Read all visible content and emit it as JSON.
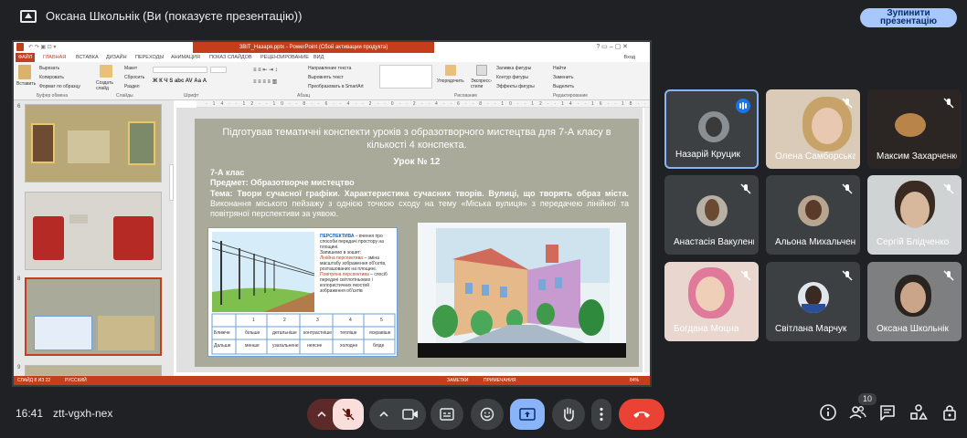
{
  "header": {
    "presenting_label": "Оксана Школьнік (Ви (показуєте презентацію))",
    "stop_button": "Зупинити презентацію",
    "stop_line1": "Зупинити",
    "stop_line2": "презентацію"
  },
  "ppt": {
    "window_title": "ЗВІТ_Назаря.pptx - PowerPoint (Сбой активации продукта)",
    "login": "Вход",
    "tabs": [
      "ФАЙЛ",
      "ГЛАВНАЯ",
      "ВСТАВКА",
      "ДИЗАЙН",
      "ПЕРЕХОДЫ",
      "АНИМАЦИЯ",
      "ПОКАЗ СЛАЙДОВ",
      "РЕЦЕНЗИРОВАНИЕ",
      "ВИД"
    ],
    "ribbon": {
      "paste": "Вставить",
      "cut": "Вырезать",
      "copy": "Копировать",
      "format_painter": "Формат по образцу",
      "clipboard_group": "Буфер обмена",
      "create_slide": "Создать слайд",
      "layout": "Макет",
      "reset": "Сбросить",
      "section": "Раздел",
      "slides_group": "Слайды",
      "font_group": "Шрифт",
      "text_direction": "Направление текста",
      "align_text": "Выровнять текст",
      "smartart": "Преобразовать в SmartArt",
      "paragraph_group": "Абзац",
      "arrange": "Упорядочить",
      "express_styles": "Экспресс-стили",
      "shape_fill": "Заливка фигуры",
      "shape_outline": "Контур фигуры",
      "shape_effects": "Эффекты фигуры",
      "drawing_group": "Рисование",
      "find": "Найти",
      "replace": "Заменить",
      "select": "Выделить",
      "editing_group": "Редактирование"
    },
    "slide_numbers": [
      "6",
      "7",
      "8",
      "9"
    ],
    "slide": {
      "title": "Підготував тематичні конспекти уроків з образотворчого мистецтва для 7-А класу в кількості 4 конспекта.",
      "lesson": "Урок № 12",
      "class_label": "7-А клас",
      "subject": "Предмет: Образотворче мистецтво",
      "theme_bold": "Тема: Твори сучасної графіки. Характеристика сучасних творів. Вулиці, що творять образ міста.",
      "theme_plain": " Виконання міського пейзажу з однією точкою сходу на тему «Міська вулиця» з передачею лінійної та повітряної перспективи за уявою.",
      "perspective_heading": "ПЕРСПЕКТИВА",
      "perspective_text": " – вчення про способи передачі простору на площині.",
      "remember": "Запишемо в зошит:",
      "linear_label": "Лінійна перспектива",
      "linear_text": " – зміна масштабу зображення об'єктів, розташованих на площині.",
      "aerial_label": "Повітряна перспектива",
      "aerial_text": " – спосіб передачі світлотіньових і колористичних якостей зображення об'єктів",
      "table_header": [
        "",
        "1",
        "2",
        "3",
        "4",
        "5"
      ],
      "table_row1": [
        "Ближче",
        "більше",
        "детальніше",
        "контрастніше",
        "тепліше",
        "яскравіше"
      ],
      "table_row2": [
        "Дальше",
        "менше",
        "узагальнене",
        "неясне",
        "холодне",
        "бліде"
      ]
    },
    "status": {
      "slide_of": "СЛАЙД 8 ИЗ 22",
      "language": "РУССКИЙ",
      "notes": "ЗАМЕТКИ",
      "comments": "ПРИМЕЧАНИЯ",
      "zoom": "84%"
    }
  },
  "participants": [
    {
      "name": "Назарій Круцик",
      "state": "speaking"
    },
    {
      "name": "Олена Самборська",
      "state": "muted"
    },
    {
      "name": "Максим Захарченко",
      "state": "muted"
    },
    {
      "name": "Анастасія Вакуленко",
      "state": "muted"
    },
    {
      "name": "Альона Михальченко",
      "state": "muted"
    },
    {
      "name": "Сергій Блідченко",
      "state": "muted"
    },
    {
      "name": "Богдана Моцна",
      "state": "muted"
    },
    {
      "name": "Світлана Марчук",
      "state": "muted"
    },
    {
      "name": "Оксана Школьнік",
      "state": "muted"
    }
  ],
  "bottombar": {
    "time": "16:41",
    "meeting_code": "ztt-vgxh-nex",
    "people_count": "10"
  },
  "colors": {
    "accent": "#a8c7fa",
    "end_call": "#ea4335",
    "mic_off": "#f9dedc",
    "present": "#8ab4f8",
    "ppt_red": "#c43e1c",
    "slide_bg": "#a9aa99"
  }
}
